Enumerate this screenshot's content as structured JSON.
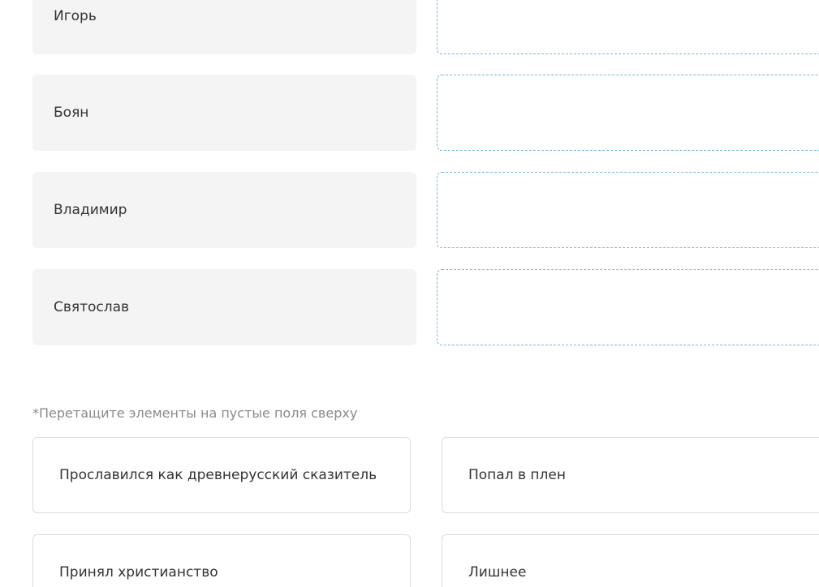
{
  "terms": [
    {
      "label": "Игорь"
    },
    {
      "label": "Боян"
    },
    {
      "label": "Владимир"
    },
    {
      "label": "Святослав"
    }
  ],
  "hint": "*Перетащите элементы на пустые поля сверху",
  "options": [
    {
      "label": "Прославился как древнерусский сказитель"
    },
    {
      "label": "Попал в плен"
    },
    {
      "label": "Принял христианство"
    },
    {
      "label": "Лишнее"
    }
  ]
}
